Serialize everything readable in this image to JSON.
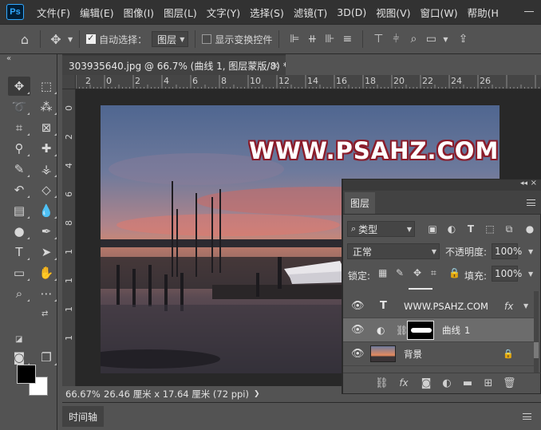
{
  "menu": {
    "logo": "Ps",
    "items": [
      "文件(F)",
      "编辑(E)",
      "图像(I)",
      "图层(L)",
      "文字(Y)",
      "选择(S)",
      "滤镜(T)",
      "3D(D)",
      "视图(V)",
      "窗口(W)",
      "帮助(H"
    ]
  },
  "options": {
    "auto_select_label": "自动选择：",
    "auto_select_value": "图层",
    "show_transform_label": "显示变换控件"
  },
  "document": {
    "tab_title": "303935640.jpg @ 66.7% (曲线 1, 图层蒙版/8) *",
    "close": "×",
    "ruler_top": [
      "2",
      "0",
      "2",
      "4",
      "6",
      "8",
      "10",
      "12",
      "14",
      "16",
      "18",
      "20",
      "22",
      "24",
      "26"
    ],
    "ruler_left": [
      "0",
      "2",
      "4",
      "6",
      "8",
      "1",
      "1",
      "1",
      "1"
    ],
    "watermark": "WWW.PSAHZ.COM"
  },
  "status": {
    "zoom": "66.67%",
    "dimensions": "26.46 厘米 x 17.64 厘米 (72 ppi)",
    "arrow": "❯"
  },
  "timeline": {
    "tab": "时间轴"
  },
  "layers_panel": {
    "tab": "图层",
    "filter_label": "类型",
    "blend_mode": "正常",
    "opacity_label": "不透明度:",
    "opacity_value": "100%",
    "lock_label": "锁定:",
    "fill_label": "填充:",
    "fill_value": "100%",
    "layers": [
      {
        "name": "WWW.PSAHZ.COM",
        "type_glyph": "T",
        "fx": "fx"
      },
      {
        "name": "曲线",
        "suffix": "1"
      },
      {
        "name": "背景"
      }
    ]
  },
  "colors": {
    "ui_dark": "#323232",
    "ui_panel": "#535353",
    "watermark_stroke": "#8b1c2a",
    "ps_blue": "#31a8ff"
  }
}
